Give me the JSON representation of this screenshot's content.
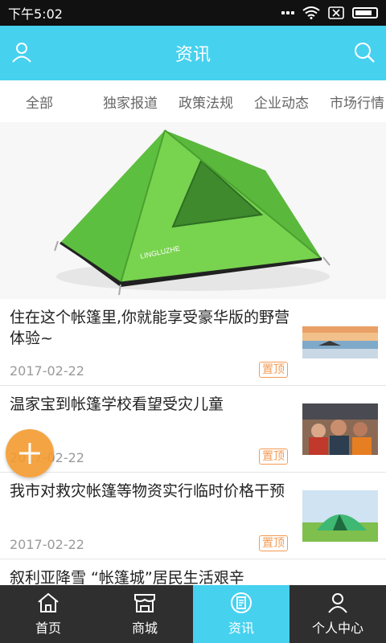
{
  "status_bar": {
    "time": "下午5:02"
  },
  "header": {
    "title": "资讯",
    "left_icon": "user-icon",
    "right_icon": "search-icon"
  },
  "tabs": [
    {
      "label": "全部"
    },
    {
      "label": "独家报道"
    },
    {
      "label": "政策法规"
    },
    {
      "label": "企业动态"
    },
    {
      "label": "市场行情"
    }
  ],
  "hero": {
    "image": "green-camping-tent"
  },
  "news": [
    {
      "title": "住在这个帐篷里,你就能享受豪华版的野营体验~",
      "date": "2017-02-22",
      "badge": "置顶",
      "thumb": "beach-sunset"
    },
    {
      "title": "温家宝到帐篷学校看望受灾儿童",
      "date": "2017-02-22",
      "badge": "置顶",
      "thumb": "crowd-photo"
    },
    {
      "title": "我市对救灾帐篷等物资实行临时价格干预",
      "date": "2017-02-22",
      "badge": "置顶",
      "thumb": "tent-on-grass"
    },
    {
      "title": "叙利亚降雪 “帐篷城”居民生活艰辛"
    }
  ],
  "bottom_nav": [
    {
      "label": "首页",
      "icon": "home-icon"
    },
    {
      "label": "商城",
      "icon": "store-icon"
    },
    {
      "label": "资讯",
      "icon": "news-icon",
      "active": true
    },
    {
      "label": "个人中心",
      "icon": "person-icon"
    }
  ],
  "colors": {
    "accent": "#46d1ef",
    "badge": "#f39b55",
    "fab": "#f49b2f",
    "bottom_bg": "#2f2f2f"
  }
}
